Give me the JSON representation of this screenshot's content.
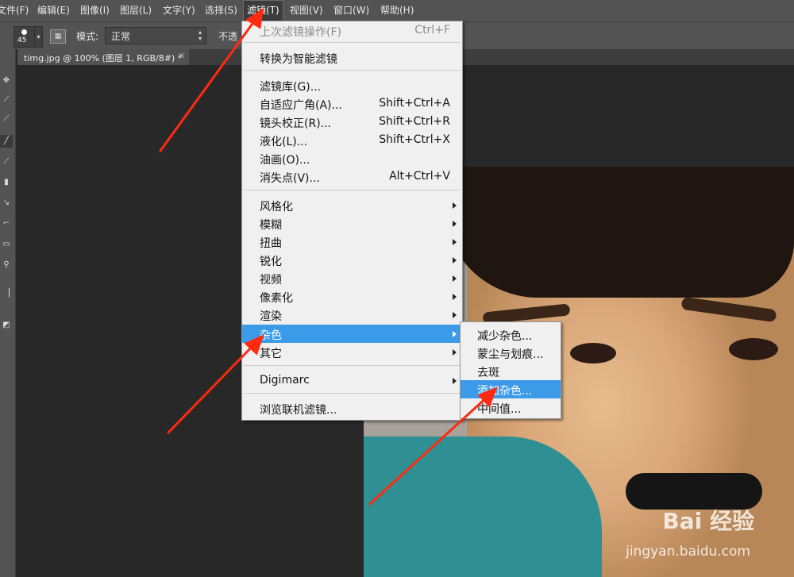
{
  "menubar": {
    "items": [
      "文件(F)",
      "编辑(E)",
      "图像(I)",
      "图层(L)",
      "文字(Y)",
      "选择(S)",
      "滤镜(T)",
      "视图(V)",
      "窗口(W)",
      "帮助(H)"
    ],
    "active_index": 6
  },
  "options_bar": {
    "brush_size": "45",
    "mode_label": "模式:",
    "mode_value": "正常",
    "opacity_label": "不透"
  },
  "document_tab": {
    "title": "timg.jpg @ 100% (图层 1, RGB/8#) *",
    "close": "×"
  },
  "filter_menu": {
    "items": [
      {
        "label": "上次滤镜操作(F)",
        "shortcut": "Ctrl+F",
        "disabled": true
      },
      {
        "label": "转换为智能滤镜"
      },
      {
        "label": "滤镜库(G)..."
      },
      {
        "label": "自适应广角(A)...",
        "shortcut": "Shift+Ctrl+A"
      },
      {
        "label": "镜头校正(R)...",
        "shortcut": "Shift+Ctrl+R"
      },
      {
        "label": "液化(L)...",
        "shortcut": "Shift+Ctrl+X"
      },
      {
        "label": "油画(O)..."
      },
      {
        "label": "消失点(V)...",
        "shortcut": "Alt+Ctrl+V"
      },
      {
        "label": "风格化",
        "submenu": true
      },
      {
        "label": "模糊",
        "submenu": true
      },
      {
        "label": "扭曲",
        "submenu": true
      },
      {
        "label": "锐化",
        "submenu": true
      },
      {
        "label": "视频",
        "submenu": true
      },
      {
        "label": "像素化",
        "submenu": true
      },
      {
        "label": "渲染",
        "submenu": true
      },
      {
        "label": "杂色",
        "submenu": true,
        "highlighted": true
      },
      {
        "label": "其它",
        "submenu": true
      },
      {
        "label": "Digimarc",
        "submenu": true
      },
      {
        "label": "浏览联机滤镜..."
      }
    ]
  },
  "noise_submenu": {
    "items": [
      {
        "label": "减少杂色..."
      },
      {
        "label": "蒙尘与划痕..."
      },
      {
        "label": "去斑"
      },
      {
        "label": "添加杂色...",
        "highlighted": true
      },
      {
        "label": "中间值..."
      }
    ]
  },
  "watermark": {
    "brand": "Bai 经验",
    "url": "jingyan.baidu.com"
  },
  "colors": {
    "menu_highlight": "#3c9be8",
    "arrow": "#ff2a10",
    "workspace": "#282828",
    "chrome": "#535353"
  },
  "icons": [
    "move-icon",
    "lasso-icon",
    "eyedropper-icon",
    "brush-icon",
    "gradient-icon",
    "zoom-icon",
    "pen-icon",
    "submenu-arrow-icon"
  ]
}
